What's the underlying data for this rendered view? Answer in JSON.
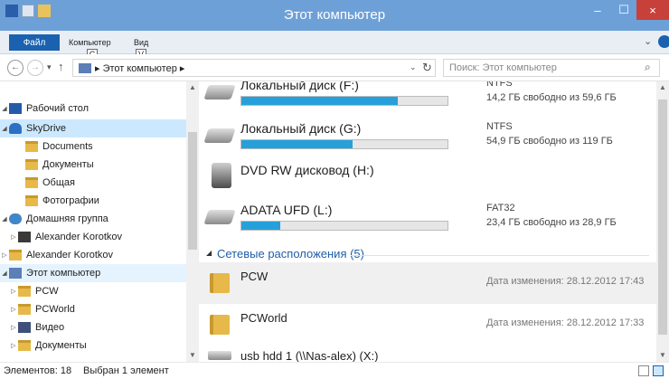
{
  "window": {
    "title": "Этот компьютер",
    "qat_icons": [
      "explorer-icon",
      "properties-icon",
      "new-folder-icon"
    ],
    "min_glyph": "–",
    "max_glyph": "☐",
    "close_glyph": "×"
  },
  "ribbon": {
    "file_tab": "Файл",
    "tab_computer": "Компьютер",
    "tab_view": "Вид",
    "keytip_computer": "C",
    "keytip_view": "V",
    "expand_glyph": "⌄"
  },
  "address": {
    "back_glyph": "←",
    "forward_glyph": "→",
    "recent_glyph": "▾",
    "up_glyph": "↑",
    "path": "▸ Этот компьютер ▸",
    "dropdown_glyph": "⌄",
    "refresh_glyph": "↻",
    "search_placeholder": "Поиск: Этот компьютер",
    "search_glyph": "⌕"
  },
  "nav_tree": [
    {
      "label": "Рабочий стол",
      "expander": "◢",
      "icon": "desktop-icon"
    },
    {
      "label": "SkyDrive",
      "expander": "◢",
      "icon": "skydrive-icon"
    },
    {
      "label": "Documents",
      "expander": "",
      "icon": "folder-icon"
    },
    {
      "label": "Документы",
      "expander": "",
      "icon": "folder-icon"
    },
    {
      "label": "Общая",
      "expander": "",
      "icon": "folder-icon"
    },
    {
      "label": "Фотографии",
      "expander": "",
      "icon": "folder-icon"
    },
    {
      "label": "Домашняя группа",
      "expander": "◢",
      "icon": "homegroup-icon"
    },
    {
      "label": "Alexander Korotkov",
      "expander": "▷",
      "icon": "user-icon"
    },
    {
      "label": "Alexander Korotkov",
      "expander": "▷",
      "icon": "user-folder-icon"
    },
    {
      "label": "Этот компьютер",
      "expander": "◢",
      "icon": "computer-icon"
    },
    {
      "label": "PCW",
      "expander": "▷",
      "icon": "folder-icon"
    },
    {
      "label": "PCWorld",
      "expander": "▷",
      "icon": "folder-icon"
    },
    {
      "label": "Видео",
      "expander": "▷",
      "icon": "video-icon"
    },
    {
      "label": "Документы",
      "expander": "▷",
      "icon": "folder-icon"
    }
  ],
  "scroll": {
    "up_glyph": "▲",
    "down_glyph": "▼"
  },
  "drives": [
    {
      "name": "Локальный диск (F:)",
      "fs": "NTFS",
      "free": "14,2 ГБ свободно из 59,6 ГБ",
      "used_fraction": 0.76,
      "icon": "hard-drive-icon"
    },
    {
      "name": "Локальный диск (G:)",
      "fs": "NTFS",
      "free": "54,9 ГБ свободно из 119 ГБ",
      "used_fraction": 0.54,
      "icon": "hard-drive-icon"
    },
    {
      "name": "DVD RW дисковод (H:)",
      "fs": "",
      "free": "",
      "used_fraction": null,
      "icon": "dvd-drive-icon"
    },
    {
      "name": "ADATA UFD (L:)",
      "fs": "FAT32",
      "free": "23,4 ГБ свободно из 28,9 ГБ",
      "used_fraction": 0.19,
      "icon": "usb-drive-icon"
    }
  ],
  "network_group": {
    "arrow": "◢",
    "label": "Сетевые расположения (5)"
  },
  "network_locations": [
    {
      "name": "PCW",
      "date": "Дата изменения: 28.12.2012 17:43",
      "selected": true,
      "icon": "network-folder-icon"
    },
    {
      "name": "PCWorld",
      "date": "Дата изменения: 28.12.2012 17:33",
      "selected": false,
      "icon": "network-folder-icon"
    },
    {
      "name": "usb hdd 1 (\\\\Nas-alex) (X:)",
      "date": "",
      "selected": false,
      "icon": "network-drive-icon"
    }
  ],
  "status": {
    "count": "Элементов: 18",
    "selection": "Выбран 1 элемент"
  },
  "colors": {
    "accent": "#26a0da",
    "title_bar": "#6ea0d8",
    "close": "#c7413a",
    "selection": "#cce8ff"
  }
}
